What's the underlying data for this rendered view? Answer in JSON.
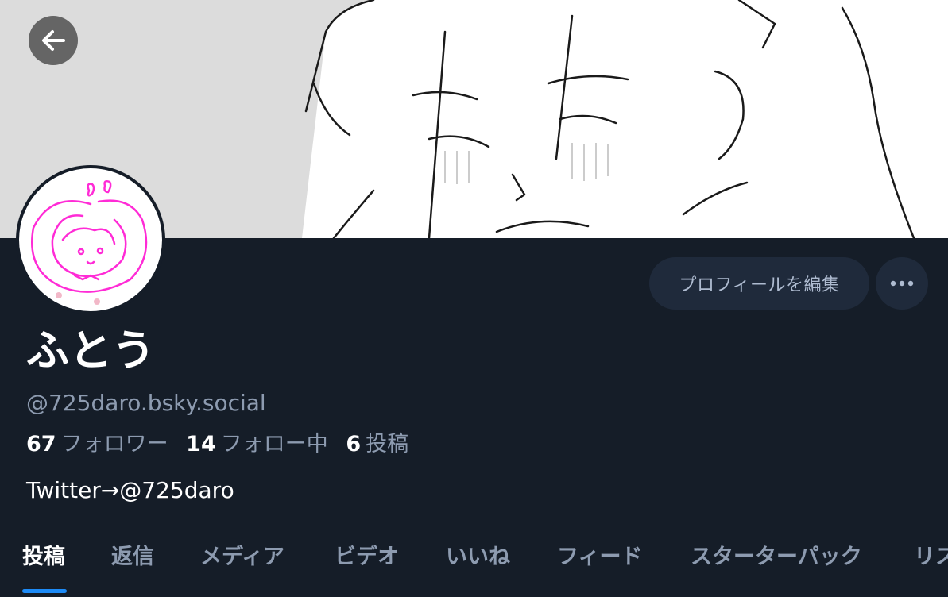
{
  "profile": {
    "display_name": "ふとう",
    "handle": "@725daro.bsky.social",
    "bio": "Twitter→@725daro",
    "stats": {
      "followers_count": "67",
      "followers_label": "フォロワー",
      "following_count": "14",
      "following_label": "フォロー中",
      "posts_count": "6",
      "posts_label": "投稿"
    }
  },
  "actions": {
    "edit_profile_label": "プロフィールを編集",
    "more_icon": "ellipsis-icon",
    "back_icon": "arrow-left-icon"
  },
  "tabs": [
    {
      "label": "投稿",
      "active": true
    },
    {
      "label": "返信"
    },
    {
      "label": "メディア"
    },
    {
      "label": "ビデオ"
    },
    {
      "label": "いいね"
    },
    {
      "label": "フィード"
    },
    {
      "label": "スターターパック"
    },
    {
      "label": "リス"
    }
  ],
  "colors": {
    "background": "#151d28",
    "button": "#1f2a3b",
    "accent": "#1d8bf7",
    "muted_text": "#8d9bb0",
    "avatar_drawing": "#ff2bd6"
  }
}
